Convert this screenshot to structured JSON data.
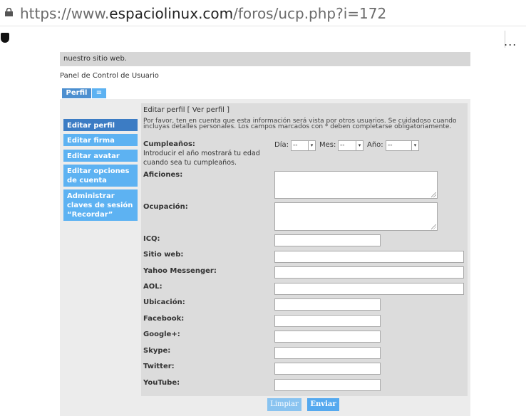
{
  "browser": {
    "url_scheme": "https://www.",
    "url_domain": "espaciolinux.com",
    "url_path": "/foros/ucp.php?i=172",
    "more": "..."
  },
  "notice": {
    "text": "nuestro sitio web."
  },
  "page": {
    "title": "Panel de Control de Usuario"
  },
  "tabs": {
    "perfil": "Perfil",
    "menu": "≡"
  },
  "sidebar": {
    "items": [
      {
        "label": "Editar perfil",
        "active": true
      },
      {
        "label": "Editar firma"
      },
      {
        "label": "Editar avatar"
      },
      {
        "label": "Editar opciones de cuenta"
      },
      {
        "label": "Administrar claves de sesión “Recordar”"
      }
    ]
  },
  "form": {
    "breadcrumb": "Editar perfil [ Ver perfil ]",
    "info": "Por favor, ten en cuenta que esta información será vista por otros usuarios. Se cuidadoso cuando incluyas detalles personales. Los campos marcados con * deben completarse obligatoriamente.",
    "birthday": {
      "label": "Cumpleaños:",
      "hint": "Introducir el año mostrará tu edad cuando sea tu cumpleaños.",
      "day_label": "Día:",
      "month_label": "Mes:",
      "year_label": "Año:",
      "day_value": "--",
      "month_value": "--",
      "year_value": "--"
    },
    "fields": {
      "aficiones": "Aficiones:",
      "ocupacion": "Ocupación:",
      "icq": "ICQ:",
      "website": "Sitio web:",
      "yahoo": "Yahoo Messenger:",
      "aol": "AOL:",
      "ubicacion": "Ubicación:",
      "facebook": "Facebook:",
      "google": "Google+:",
      "skype": "Skype:",
      "twitter": "Twitter:",
      "youtube": "YouTube:"
    },
    "buttons": {
      "reset": "Limpiar",
      "submit": "Enviar"
    }
  },
  "colors": {
    "sidebar": "#5db2f2",
    "sidebar_active": "#3c7cc4",
    "submit": "#55a9ef",
    "reset": "#89c3f0"
  }
}
